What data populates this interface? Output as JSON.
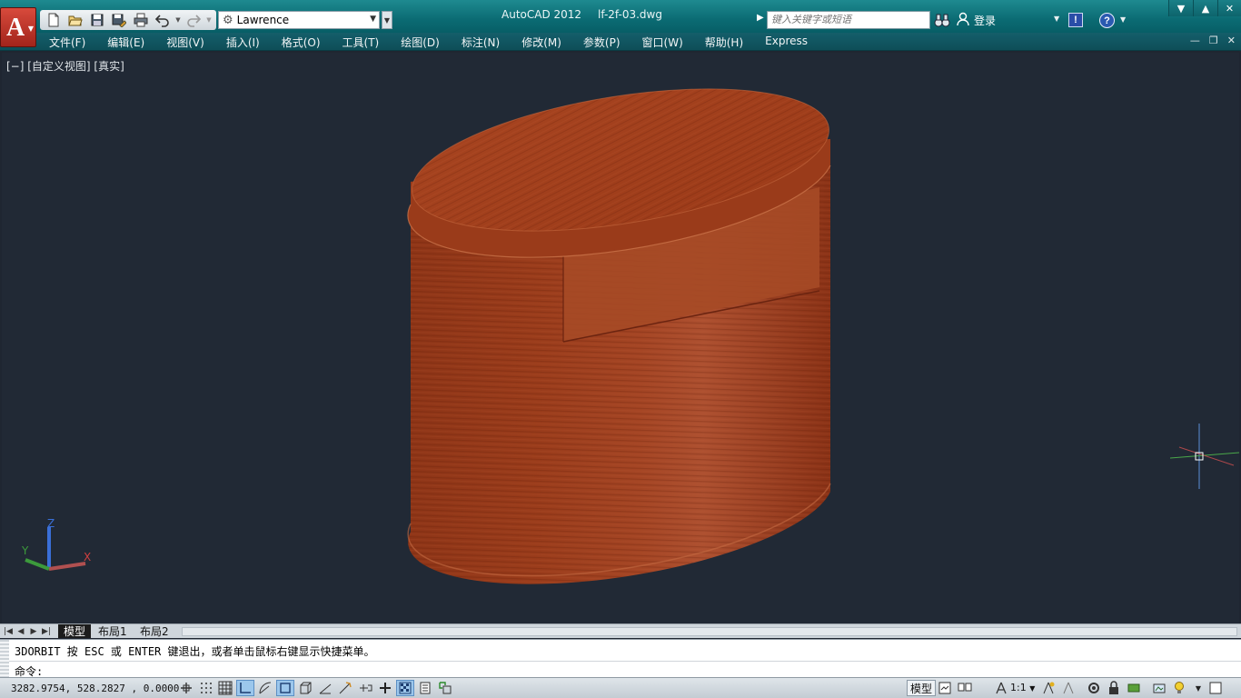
{
  "app": {
    "name": "AutoCAD 2012",
    "document": "lf-2f-03.dwg",
    "app_button_glyph": "A"
  },
  "quick_access": {
    "icons": [
      "new-icon",
      "open-icon",
      "save-icon",
      "save-as-icon",
      "plot-icon",
      "undo-icon",
      "redo-icon"
    ],
    "workspace": "Lawrence"
  },
  "search": {
    "placeholder": "键入关键字或短语"
  },
  "account": {
    "login_label": "登录"
  },
  "menu": {
    "items": [
      "文件(F)",
      "编辑(E)",
      "视图(V)",
      "插入(I)",
      "格式(O)",
      "工具(T)",
      "绘图(D)",
      "标注(N)",
      "修改(M)",
      "参数(P)",
      "窗口(W)",
      "帮助(H)",
      "Express"
    ]
  },
  "viewport": {
    "label": "[−] [自定义视图] [真实]",
    "ucs": {
      "x": "X",
      "y": "Y",
      "z": "Z"
    },
    "colors": {
      "background": "#212935",
      "wood_light": "#a34a28",
      "wood_dark": "#6b2410"
    }
  },
  "layout_tabs": {
    "tabs": [
      "模型",
      "布局1",
      "布局2"
    ],
    "active": "模型"
  },
  "command_line": {
    "history": "3DORBIT 按 ESC 或 ENTER 键退出，或者单击鼠标右键显示快捷菜单。",
    "prompt": "命令:",
    "input_value": ""
  },
  "status_bar": {
    "coordinates": "3282.9754, 528.2827 , 0.0000",
    "model_label": "模型",
    "annotation_scale": "1:1"
  }
}
